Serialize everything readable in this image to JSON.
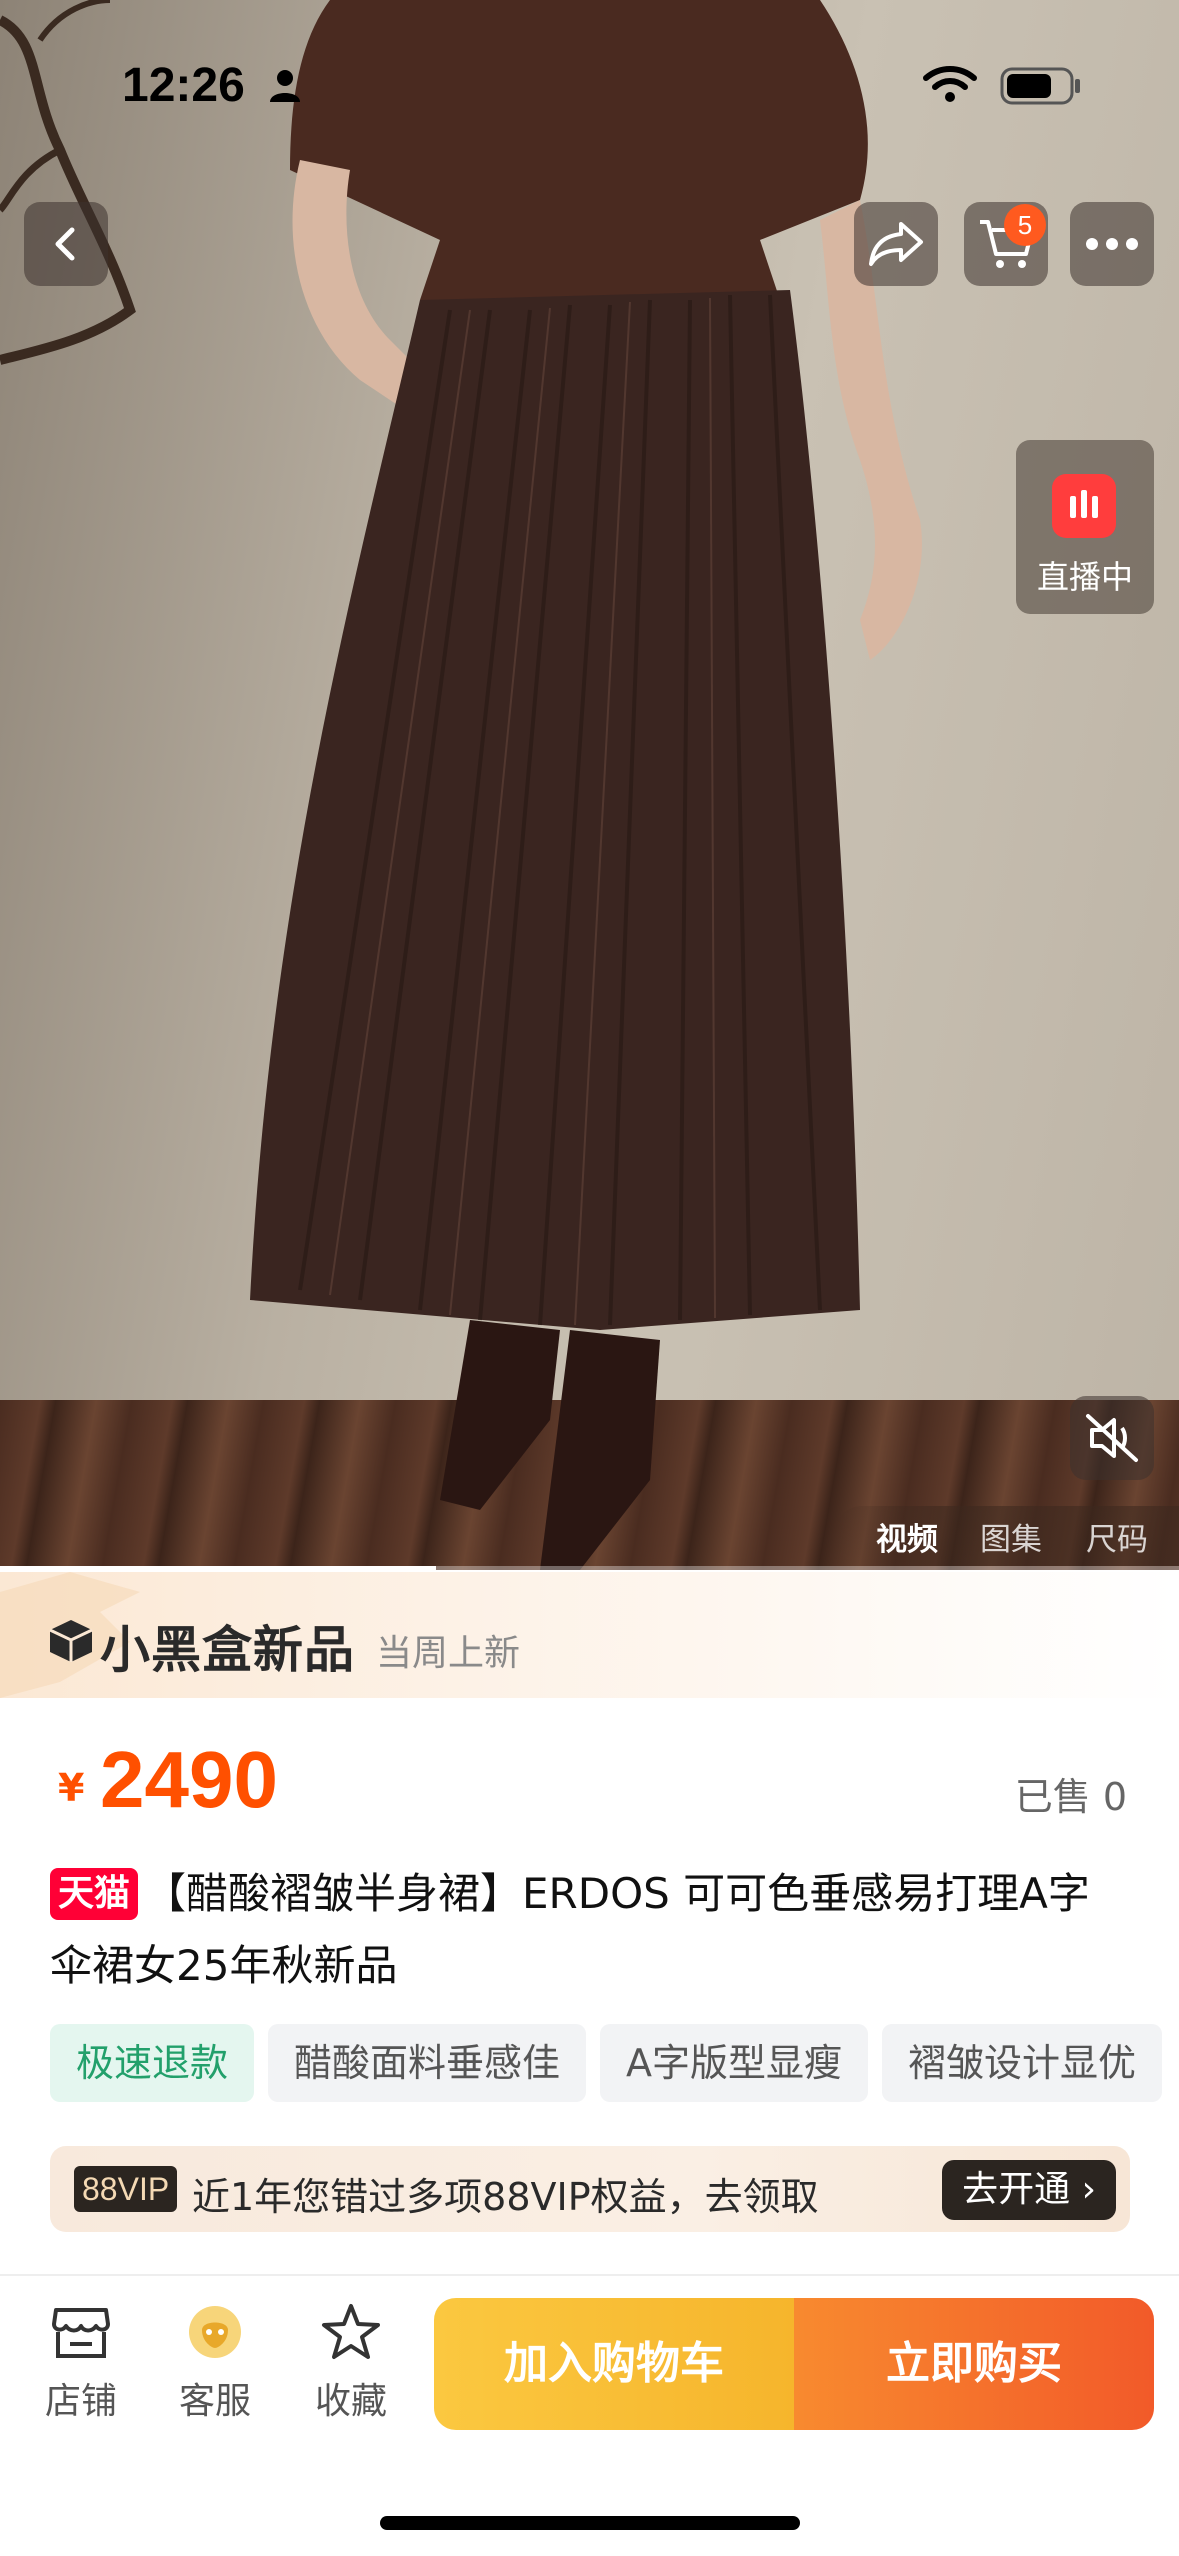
{
  "status_bar": {
    "time": "12:26"
  },
  "top_nav": {
    "cart_count": "5"
  },
  "live": {
    "label": "直播中"
  },
  "media_tabs": [
    "视频",
    "图集",
    "尺码"
  ],
  "media_progress": 0.37,
  "banner": {
    "title": "小黑盒新品",
    "subtitle": "当周上新"
  },
  "price": {
    "currency": "¥",
    "value": "2490",
    "sold": "已售 0"
  },
  "product": {
    "platform_badge": "天猫",
    "title": "【醋酸褶皱半身裙】ERDOS 可可色垂感易打理A字伞裙女25年秋新品"
  },
  "tags": [
    "极速退款",
    "醋酸面料垂感佳",
    "A字版型显瘦",
    "褶皱设计显优"
  ],
  "vip": {
    "badge": "88VIP",
    "text": "近1年您错过多项88VIP权益，去领取",
    "button": "去开通 ›"
  },
  "bottom_bar": {
    "store": "店铺",
    "service": "客服",
    "favorite": "收藏",
    "add_to_cart": "加入购物车",
    "buy_now": "立即购买"
  },
  "colors": {
    "accent": "#ff5000",
    "tmall": "#ff0036",
    "cart_button": "#f6b52c",
    "buy_button": "#f25a29"
  }
}
